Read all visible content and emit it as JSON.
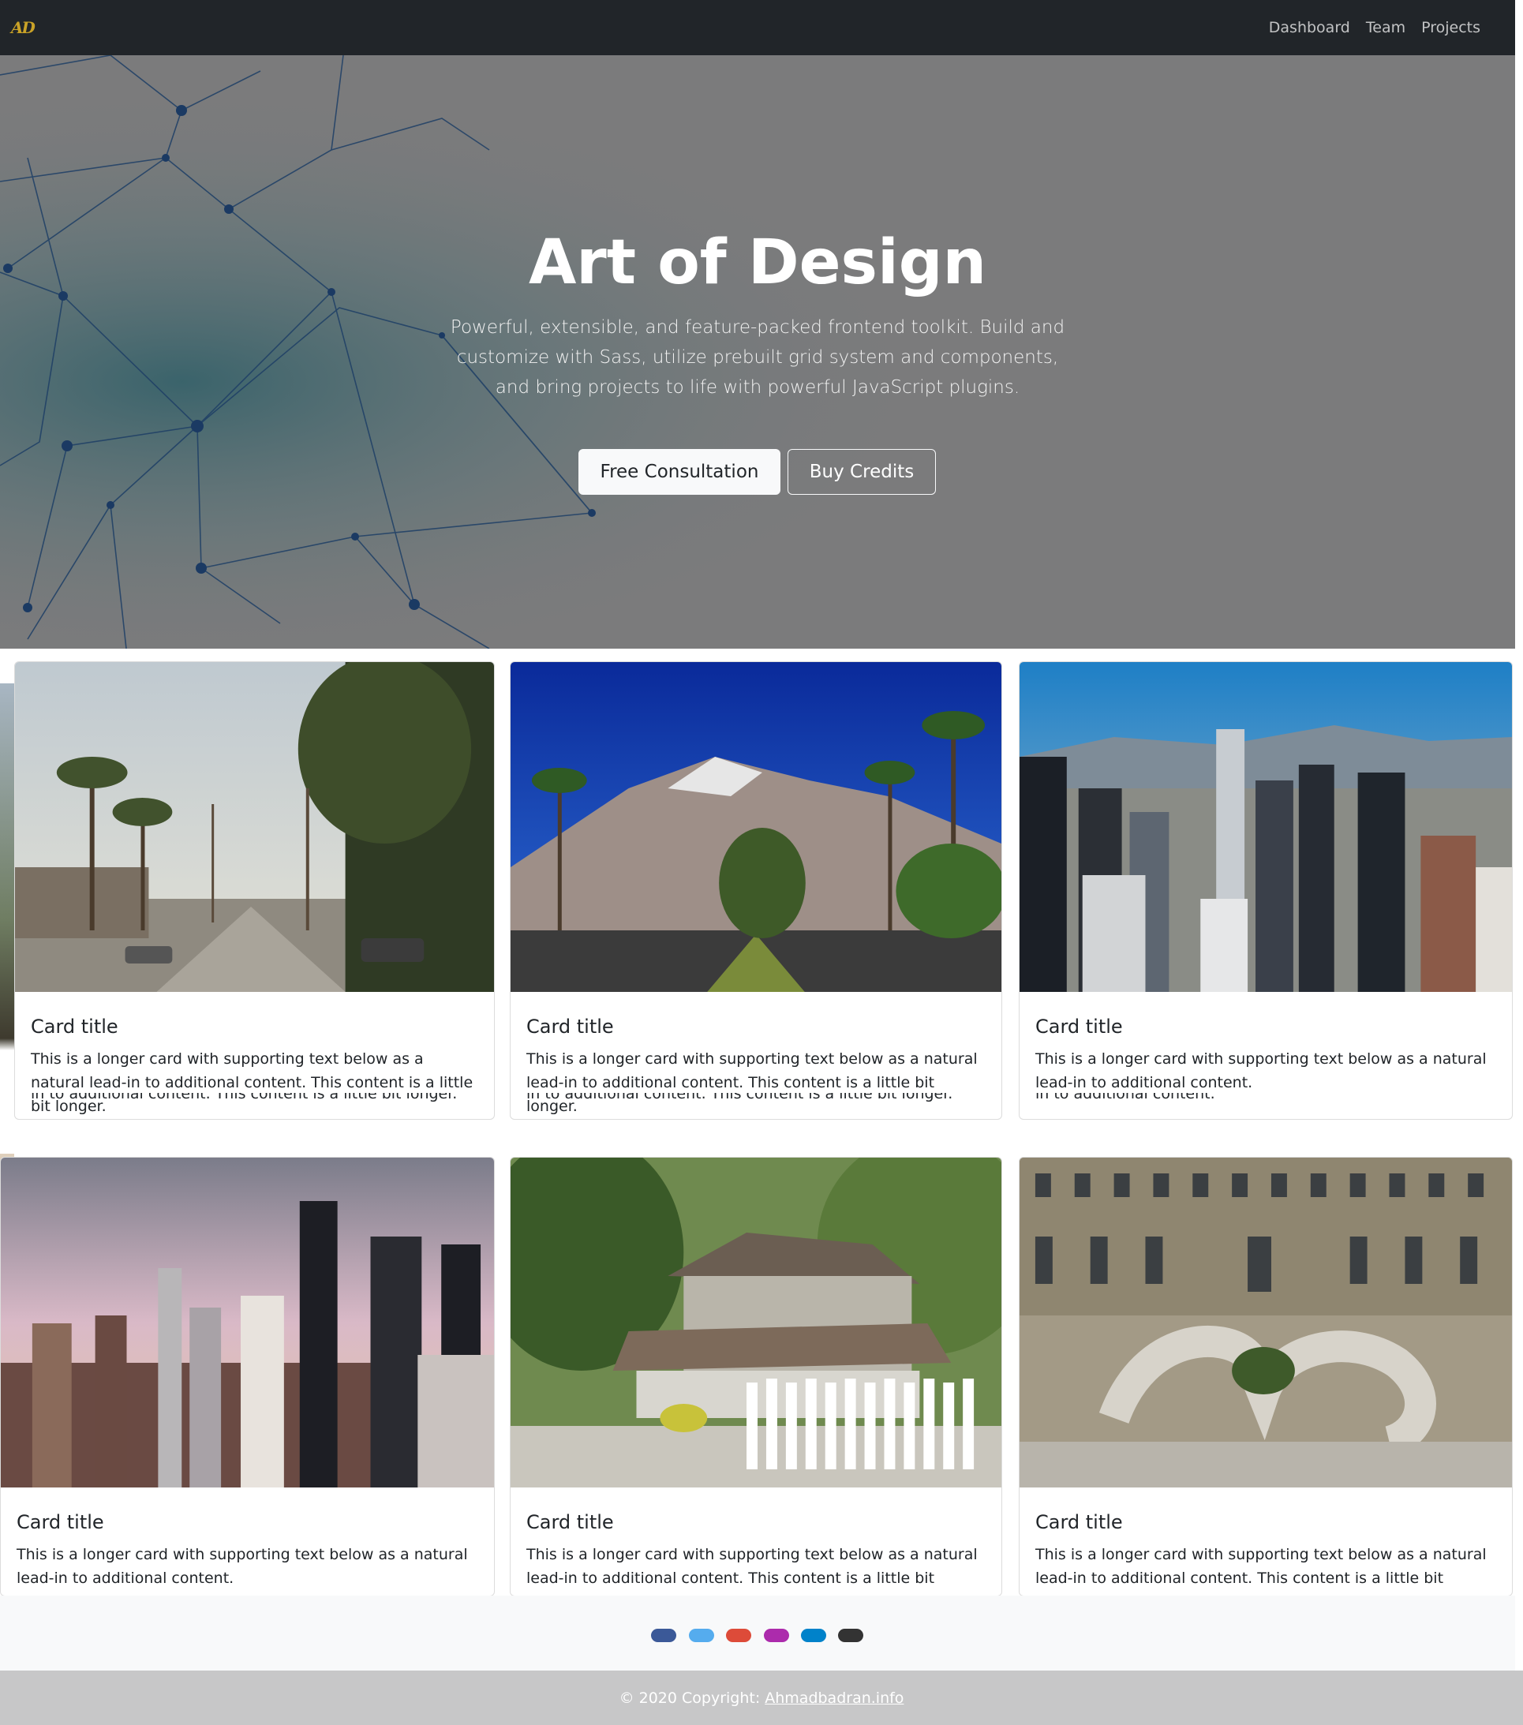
{
  "navbar": {
    "brand": "AD",
    "links": [
      "Dashboard",
      "Team",
      "Projects"
    ]
  },
  "hero": {
    "title": "Art of Design",
    "text": "Powerful, extensible, and feature-packed frontend toolkit. Build and customize with Sass, utilize prebuilt grid system and components, and bring projects to life with powerful JavaScript plugins.",
    "primary_button": "Free Consultation",
    "secondary_button": "Buy Credits"
  },
  "cards": [
    {
      "title": "Card title",
      "text": "This is a longer card with supporting text below as a natural lead-in to additional content. This content is a little bit longer.",
      "ghost": "in to additional content. This content is a little bit longer.",
      "image": "hollywood-street-palm-trees"
    },
    {
      "title": "Card title",
      "text": "This is a longer card with supporting text below as a natural lead-in to additional content. This content is a little bit longer.",
      "ghost": "in to additional content. This content is a little bit longer.",
      "image": "palm-springs-mountain-road"
    },
    {
      "title": "Card title",
      "text": "This is a longer card with supporting text below as a natural lead-in to additional content.",
      "ghost": "in to additional content.",
      "image": "los-angeles-skyline-aerial"
    },
    {
      "title": "Card title",
      "text": "This is a longer card with supporting text below as a natural lead-in to additional content.",
      "image": "downtown-skyline-sunset"
    },
    {
      "title": "Card title",
      "text": "This is a longer card with supporting text below as a natural lead-in to additional content. This content is a little bit longer.",
      "image": "house-with-white-picket-fence"
    },
    {
      "title": "Card title",
      "text": "This is a longer card with supporting text below as a natural lead-in to additional content. This content is a little bit longer.",
      "image": "palace-courtyard-staircase"
    }
  ],
  "social": [
    {
      "name": "facebook-icon",
      "color": "#3b5998"
    },
    {
      "name": "twitter-icon",
      "color": "#55acee"
    },
    {
      "name": "google-icon",
      "color": "#dd4b39"
    },
    {
      "name": "instagram-icon",
      "color": "#ac2bac"
    },
    {
      "name": "linkedin-icon",
      "color": "#0082ca"
    },
    {
      "name": "github-icon",
      "color": "#333333"
    }
  ],
  "footer": {
    "copyright": "© 2020 Copyright:",
    "link": "Ahmadbadran.info"
  }
}
